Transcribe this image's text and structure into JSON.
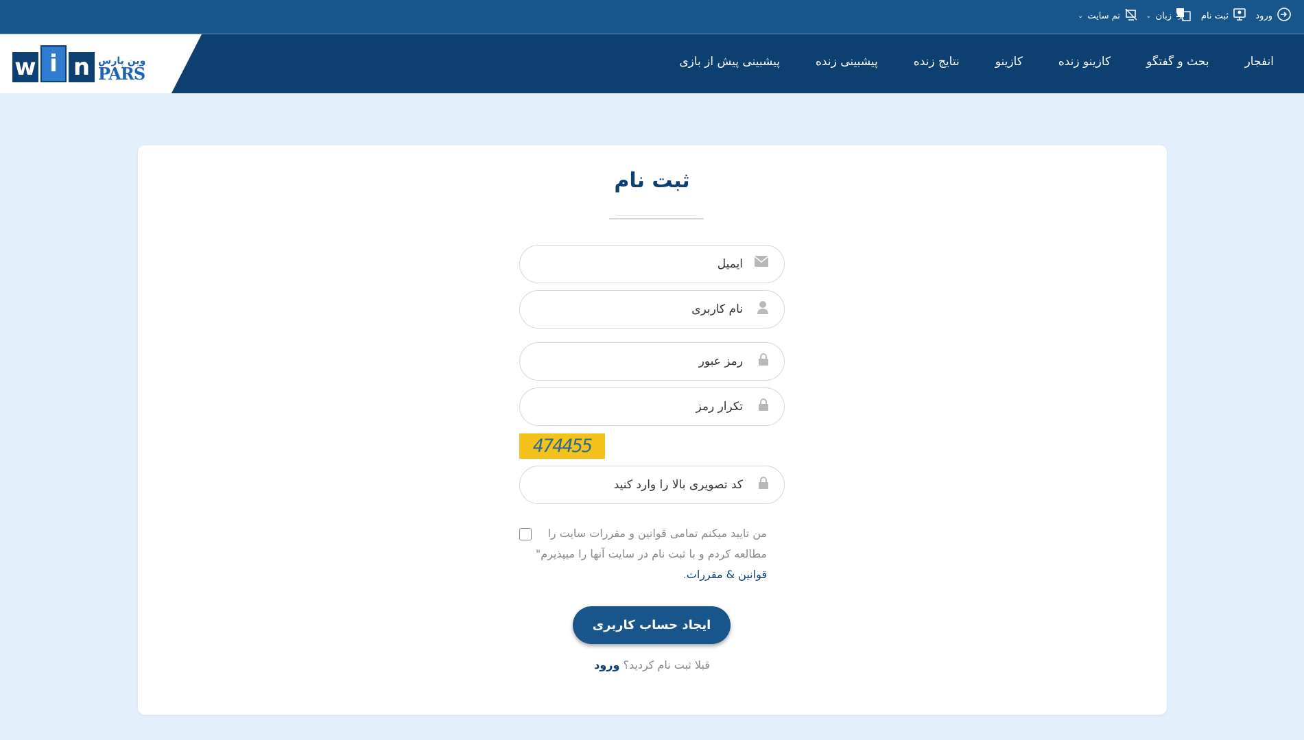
{
  "topbar": {
    "login": "ورود",
    "register": "ثبت نام",
    "language": "زبان",
    "theme": "تم سایت"
  },
  "logo": {
    "letters": [
      "w",
      "i",
      "n"
    ],
    "fa": "وین پارس",
    "en": "PARS"
  },
  "nav": {
    "items": [
      "پیشبینی پیش از بازی",
      "پیشبینی زنده",
      "نتایج زنده",
      "کازینو",
      "کازینو زنده",
      "بحث و گفتگو",
      "انفجار"
    ]
  },
  "form": {
    "title": "ثبت نام",
    "email_placeholder": "ایمیل",
    "username_placeholder": "نام کاربری",
    "password_placeholder": "رمز عبور",
    "password_repeat_placeholder": "تکرار رمز",
    "captcha_code": "474455",
    "captcha_placeholder": "کد تصویری بالا را وارد کنید",
    "agree_text": "من تایید میکنم تمامی قوانین و مقررات سایت را مطالعه کردم و با ثبت نام در سایت آنها را میپذیرم\"",
    "rules_link": "قوانین & مقررات",
    "rules_suffix": ".",
    "submit_label": "ایجاد حساب کاربری",
    "already_text": "قبلا ثبت نام کردید؟",
    "login_link": "ورود"
  },
  "colors": {
    "topbar": "#17558b",
    "navbar": "#0d3f70",
    "page_bg": "#e3f0fc",
    "captcha_bg": "#f5c21b"
  }
}
